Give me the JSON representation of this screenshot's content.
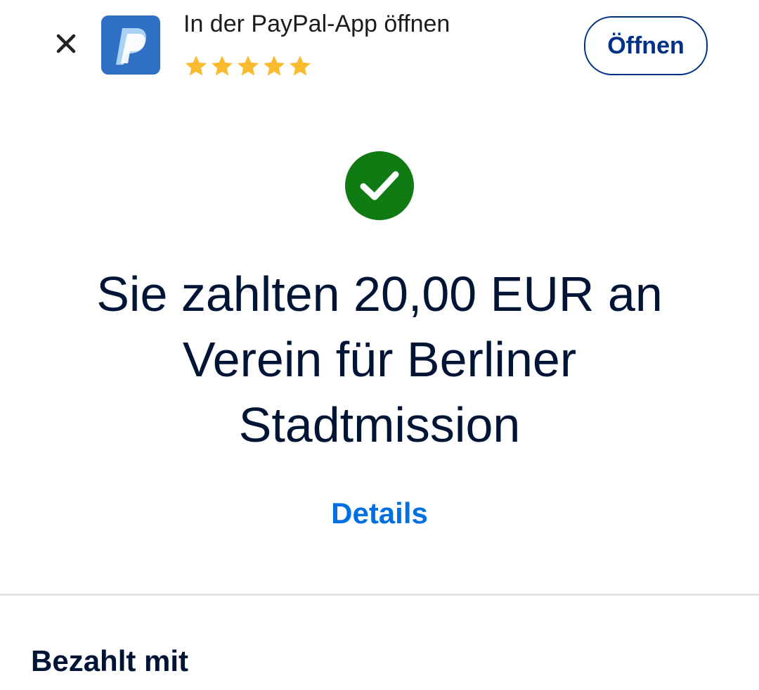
{
  "banner": {
    "title": "In der PayPal-App öffnen",
    "rating_stars": 5,
    "star_color": "#fbbb2f",
    "open_button_label": "Öffnen",
    "app_icon_color": "#2f6fc4",
    "icons": {
      "close": "close-icon",
      "app": "paypal-app-icon",
      "star": "star-icon"
    }
  },
  "confirmation": {
    "status_icon": "checkmark-circle-icon",
    "status_color": "#107a13",
    "headline": "Sie zahlten 20,00 EUR an Verein für Berliner Stadtmission",
    "details_link": "Details",
    "link_color": "#0070e0"
  },
  "payment_section": {
    "title": "Bezahlt mit"
  }
}
